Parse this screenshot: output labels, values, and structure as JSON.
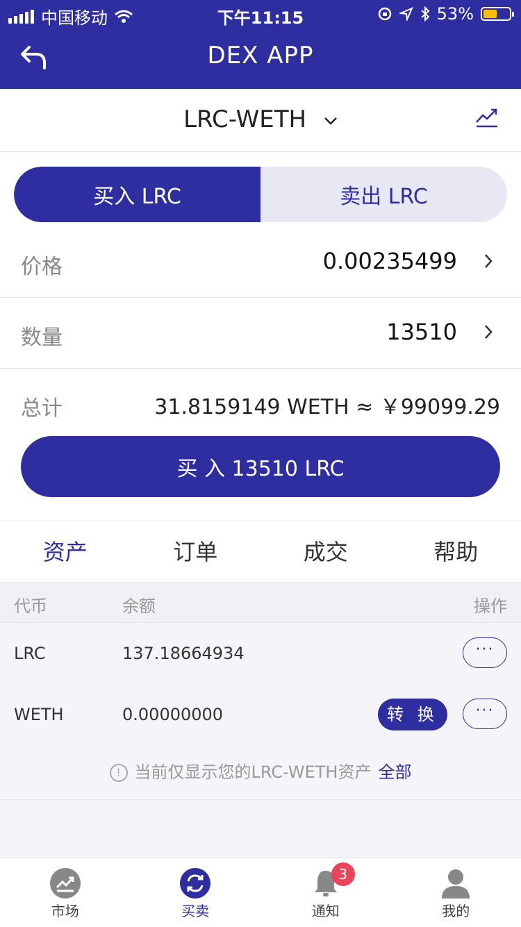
{
  "status_bar": {
    "carrier": "中国移动",
    "time": "下午11:15",
    "battery": "53%",
    "battery_level": 0.53
  },
  "nav": {
    "title": "DEX APP"
  },
  "pair": {
    "name": "LRC-WETH"
  },
  "trade": {
    "buy_tab": "买入 LRC",
    "sell_tab": "卖出 LRC",
    "price_label": "价格",
    "price_value": "0.00235499",
    "amount_label": "数量",
    "amount_value": "13510",
    "total_label": "总计",
    "total_value": "31.8159149 WETH ≈ ￥99099.29",
    "submit_label": "买 入 13510 LRC"
  },
  "tabs": [
    {
      "label": "资产",
      "active": true
    },
    {
      "label": "订单"
    },
    {
      "label": "成交"
    },
    {
      "label": "帮助"
    }
  ],
  "assets_table": {
    "headers": {
      "token": "代币",
      "balance": "余额",
      "action": "操作"
    },
    "rows": [
      {
        "token": "LRC",
        "balance": "137.18664934",
        "more": "···"
      },
      {
        "token": "WETH",
        "balance": "0.00000000",
        "convert": "转 换",
        "more": "···"
      }
    ]
  },
  "note": {
    "text": "当前仅显示您的LRC-WETH资产",
    "link": "全部"
  },
  "tabbar": [
    {
      "label": "市场",
      "icon": "market-icon"
    },
    {
      "label": "买卖",
      "icon": "trade-icon",
      "active": true
    },
    {
      "label": "通知",
      "icon": "bell-icon",
      "badge": "3"
    },
    {
      "label": "我的",
      "icon": "user-icon"
    }
  ],
  "colors": {
    "brand": "#2f2ea0",
    "badge": "#e8455a",
    "battery": "#f6c000"
  }
}
